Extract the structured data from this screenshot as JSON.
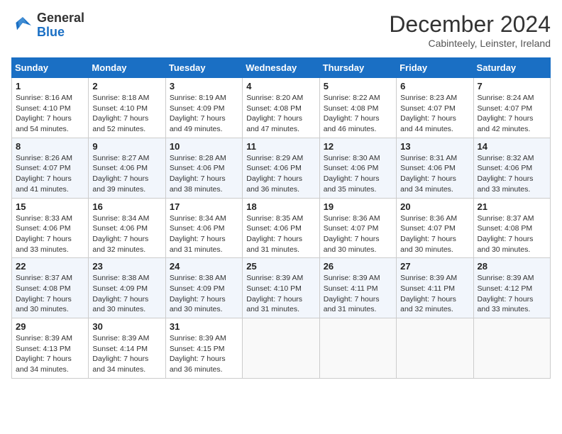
{
  "header": {
    "logo_general": "General",
    "logo_blue": "Blue",
    "month_title": "December 2024",
    "subtitle": "Cabinteely, Leinster, Ireland"
  },
  "days_of_week": [
    "Sunday",
    "Monday",
    "Tuesday",
    "Wednesday",
    "Thursday",
    "Friday",
    "Saturday"
  ],
  "weeks": [
    [
      {
        "day": "1",
        "sunrise": "8:16 AM",
        "sunset": "4:10 PM",
        "daylight": "7 hours and 54 minutes."
      },
      {
        "day": "2",
        "sunrise": "8:18 AM",
        "sunset": "4:10 PM",
        "daylight": "7 hours and 52 minutes."
      },
      {
        "day": "3",
        "sunrise": "8:19 AM",
        "sunset": "4:09 PM",
        "daylight": "7 hours and 49 minutes."
      },
      {
        "day": "4",
        "sunrise": "8:20 AM",
        "sunset": "4:08 PM",
        "daylight": "7 hours and 47 minutes."
      },
      {
        "day": "5",
        "sunrise": "8:22 AM",
        "sunset": "4:08 PM",
        "daylight": "7 hours and 46 minutes."
      },
      {
        "day": "6",
        "sunrise": "8:23 AM",
        "sunset": "4:07 PM",
        "daylight": "7 hours and 44 minutes."
      },
      {
        "day": "7",
        "sunrise": "8:24 AM",
        "sunset": "4:07 PM",
        "daylight": "7 hours and 42 minutes."
      }
    ],
    [
      {
        "day": "8",
        "sunrise": "8:26 AM",
        "sunset": "4:07 PM",
        "daylight": "7 hours and 41 minutes."
      },
      {
        "day": "9",
        "sunrise": "8:27 AM",
        "sunset": "4:06 PM",
        "daylight": "7 hours and 39 minutes."
      },
      {
        "day": "10",
        "sunrise": "8:28 AM",
        "sunset": "4:06 PM",
        "daylight": "7 hours and 38 minutes."
      },
      {
        "day": "11",
        "sunrise": "8:29 AM",
        "sunset": "4:06 PM",
        "daylight": "7 hours and 36 minutes."
      },
      {
        "day": "12",
        "sunrise": "8:30 AM",
        "sunset": "4:06 PM",
        "daylight": "7 hours and 35 minutes."
      },
      {
        "day": "13",
        "sunrise": "8:31 AM",
        "sunset": "4:06 PM",
        "daylight": "7 hours and 34 minutes."
      },
      {
        "day": "14",
        "sunrise": "8:32 AM",
        "sunset": "4:06 PM",
        "daylight": "7 hours and 33 minutes."
      }
    ],
    [
      {
        "day": "15",
        "sunrise": "8:33 AM",
        "sunset": "4:06 PM",
        "daylight": "7 hours and 33 minutes."
      },
      {
        "day": "16",
        "sunrise": "8:34 AM",
        "sunset": "4:06 PM",
        "daylight": "7 hours and 32 minutes."
      },
      {
        "day": "17",
        "sunrise": "8:34 AM",
        "sunset": "4:06 PM",
        "daylight": "7 hours and 31 minutes."
      },
      {
        "day": "18",
        "sunrise": "8:35 AM",
        "sunset": "4:06 PM",
        "daylight": "7 hours and 31 minutes."
      },
      {
        "day": "19",
        "sunrise": "8:36 AM",
        "sunset": "4:07 PM",
        "daylight": "7 hours and 30 minutes."
      },
      {
        "day": "20",
        "sunrise": "8:36 AM",
        "sunset": "4:07 PM",
        "daylight": "7 hours and 30 minutes."
      },
      {
        "day": "21",
        "sunrise": "8:37 AM",
        "sunset": "4:08 PM",
        "daylight": "7 hours and 30 minutes."
      }
    ],
    [
      {
        "day": "22",
        "sunrise": "8:37 AM",
        "sunset": "4:08 PM",
        "daylight": "7 hours and 30 minutes."
      },
      {
        "day": "23",
        "sunrise": "8:38 AM",
        "sunset": "4:09 PM",
        "daylight": "7 hours and 30 minutes."
      },
      {
        "day": "24",
        "sunrise": "8:38 AM",
        "sunset": "4:09 PM",
        "daylight": "7 hours and 30 minutes."
      },
      {
        "day": "25",
        "sunrise": "8:39 AM",
        "sunset": "4:10 PM",
        "daylight": "7 hours and 31 minutes."
      },
      {
        "day": "26",
        "sunrise": "8:39 AM",
        "sunset": "4:11 PM",
        "daylight": "7 hours and 31 minutes."
      },
      {
        "day": "27",
        "sunrise": "8:39 AM",
        "sunset": "4:11 PM",
        "daylight": "7 hours and 32 minutes."
      },
      {
        "day": "28",
        "sunrise": "8:39 AM",
        "sunset": "4:12 PM",
        "daylight": "7 hours and 33 minutes."
      }
    ],
    [
      {
        "day": "29",
        "sunrise": "8:39 AM",
        "sunset": "4:13 PM",
        "daylight": "7 hours and 34 minutes."
      },
      {
        "day": "30",
        "sunrise": "8:39 AM",
        "sunset": "4:14 PM",
        "daylight": "7 hours and 34 minutes."
      },
      {
        "day": "31",
        "sunrise": "8:39 AM",
        "sunset": "4:15 PM",
        "daylight": "7 hours and 36 minutes."
      },
      null,
      null,
      null,
      null
    ]
  ],
  "labels": {
    "sunrise": "Sunrise: ",
    "sunset": "Sunset: ",
    "daylight": "Daylight: "
  }
}
